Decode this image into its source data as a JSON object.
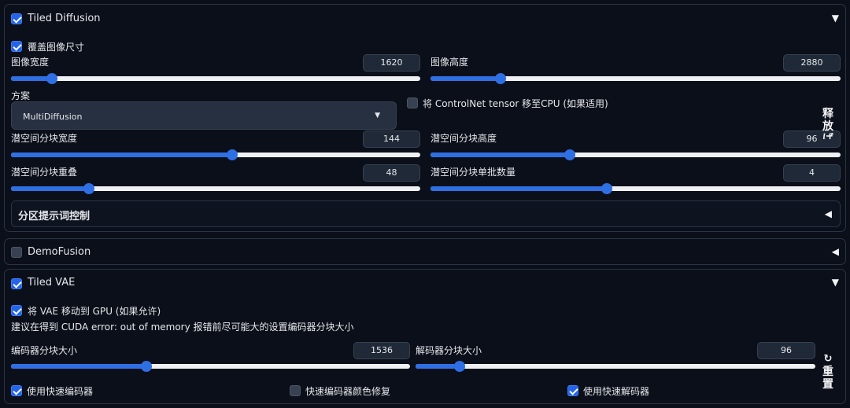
{
  "tiled_diffusion": {
    "title": "Tiled Diffusion",
    "enabled": true,
    "collapse_icon": "triangle-down-icon",
    "override_size_label": "覆盖图像尺寸",
    "image_width": {
      "label": "图像宽度",
      "value": "1620",
      "fraction": 0.1
    },
    "image_height": {
      "label": "图像高度",
      "value": "2880",
      "fraction": 0.17
    },
    "method": {
      "label": "方案",
      "value": "MultiDiffusion"
    },
    "move_controlnet_label": "将 ControlNet tensor 移至CPU (如果适用)",
    "tile_width": {
      "label": "潜空间分块宽度",
      "value": "144",
      "fraction": 0.54
    },
    "tile_height": {
      "label": "潜空间分块高度",
      "value": "96",
      "fraction": 0.34
    },
    "tile_overlap": {
      "label": "潜空间分块重叠",
      "value": "48",
      "fraction": 0.19
    },
    "tile_batch": {
      "label": "潜空间分块单批数量",
      "value": "4",
      "fraction": 0.43
    },
    "region_prompt": "分区提示词控制",
    "side_button": "释放",
    "side_extra": "ば"
  },
  "demofusion": {
    "title": "DemoFusion",
    "enabled": false
  },
  "tiled_vae": {
    "title": "Tiled VAE",
    "enabled": true,
    "move_vae_label": "将 VAE 移动到 GPU (如果允许)",
    "hint": "建议在得到 CUDA error: out of memory 报错前尽可能大的设置编码器分块大小",
    "encoder_tile": {
      "label": "编码器分块大小",
      "value": "1536",
      "fraction": 0.34
    },
    "decoder_tile": {
      "label": "解码器分块大小",
      "value": "96",
      "fraction": 0.11
    },
    "fast_encoder": {
      "label": "使用快速编码器",
      "checked": true
    },
    "fast_encoder_color": {
      "label": "快速编码器颜色修复",
      "checked": false
    },
    "fast_decoder": {
      "label": "使用快速解码器",
      "checked": true
    },
    "reset_icon": "↻",
    "reset_label": "重置"
  },
  "colors": {
    "accent": "#2f6fe4",
    "background": "#0b0f19",
    "track": "#eef0f3"
  }
}
